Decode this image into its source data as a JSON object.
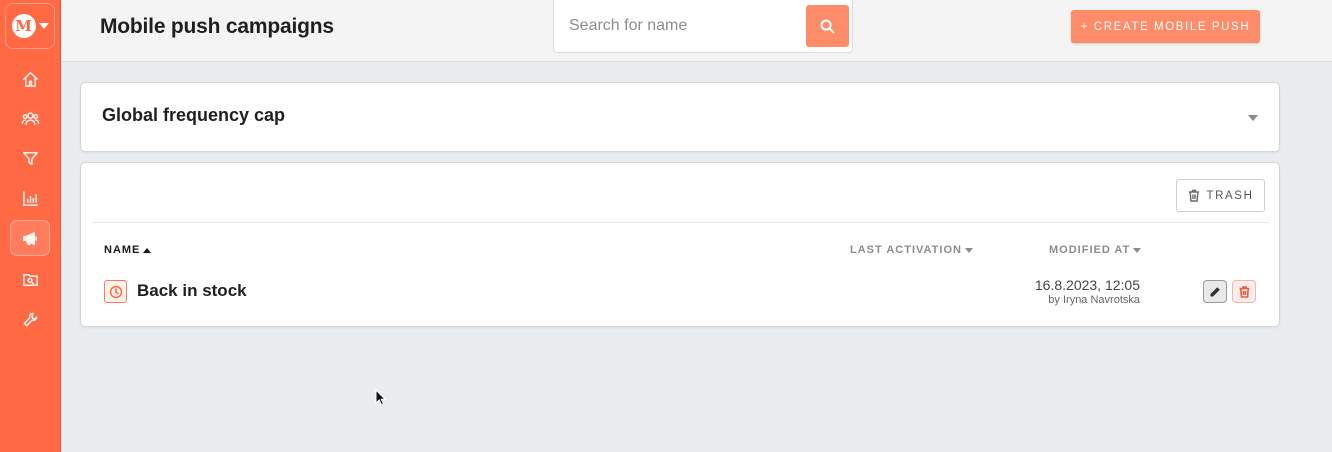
{
  "header": {
    "title": "Mobile push campaigns",
    "search_placeholder": "Search for name",
    "search_value": "",
    "create_button": "+ CREATE MOBILE PUSH"
  },
  "sidebar": {
    "logo_letter": "M",
    "items": [
      {
        "icon": "home-icon",
        "active": false
      },
      {
        "icon": "users-icon",
        "active": false
      },
      {
        "icon": "filter-icon",
        "active": false
      },
      {
        "icon": "bar-chart-icon",
        "active": false
      },
      {
        "icon": "megaphone-icon",
        "active": true
      },
      {
        "icon": "search-folder-icon",
        "active": false
      },
      {
        "icon": "wrench-icon",
        "active": false
      }
    ]
  },
  "frequency_cap": {
    "title": "Global frequency cap"
  },
  "campaigns": {
    "trash_button": "TRASH",
    "columns": {
      "name": "NAME",
      "last_activation": "LAST ACTIVATION",
      "modified_at": "MODIFIED AT"
    },
    "rows": [
      {
        "name": "Back in stock",
        "last_activation": "",
        "modified_date": "16.8.2023, 12:05",
        "modified_by": "by Iryna Navrotska",
        "status_icon": "clock-icon"
      }
    ]
  },
  "colors": {
    "brand": "#ff6944",
    "accent_button": "#ff8c69",
    "background": "#e9edf0"
  }
}
